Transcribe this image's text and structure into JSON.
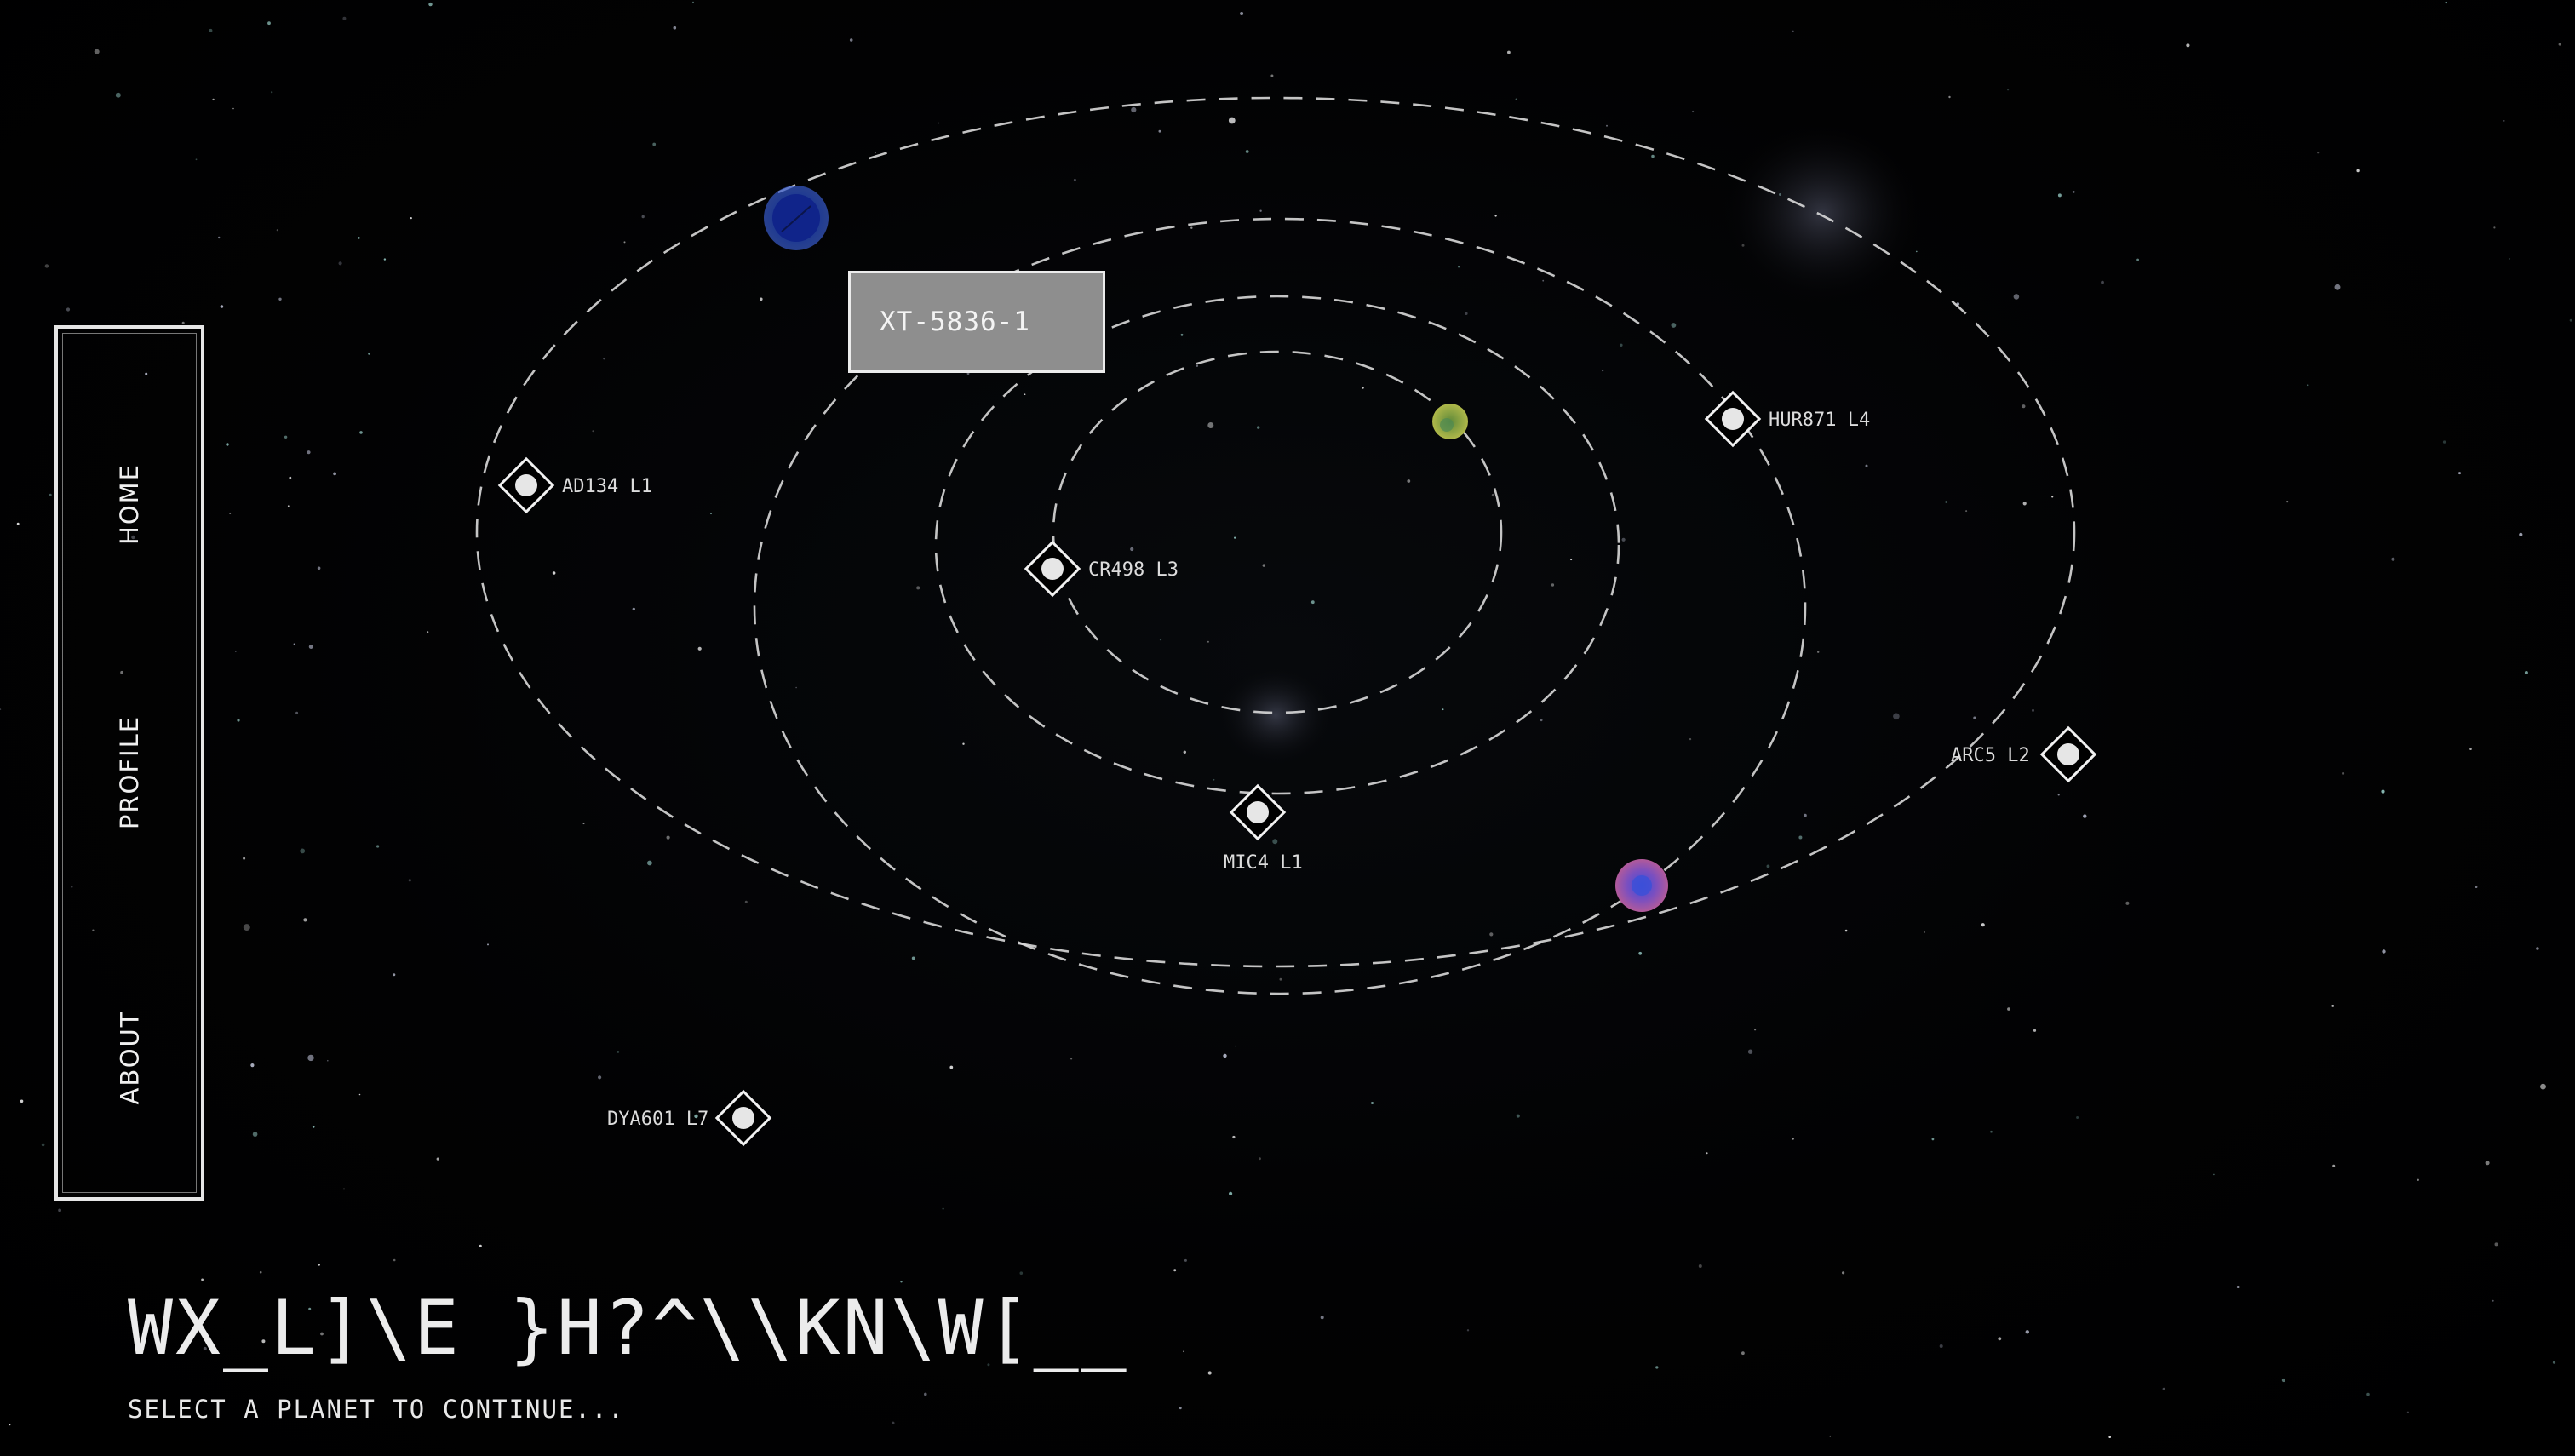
{
  "nav": {
    "items": [
      {
        "label": "HOME"
      },
      {
        "label": "PROFILE"
      },
      {
        "label": "ABOUT"
      }
    ]
  },
  "tooltip": {
    "label": "XT-5836-1"
  },
  "stations": [
    {
      "label": "AD134 L1"
    },
    {
      "label": "HUR871 L4"
    },
    {
      "label": "CR498 L3"
    },
    {
      "label": "MIC4 L1"
    },
    {
      "label": "ARC5 L2"
    },
    {
      "label": "DYA601 L7"
    }
  ],
  "planets": [
    {
      "name": "blue-planet",
      "color": "#1f3fa8"
    },
    {
      "name": "green-planet",
      "color": "#8fae3f"
    },
    {
      "name": "purple-planet",
      "color": "#8a4fb0"
    }
  ],
  "title": {
    "text": "WX_L]\\E }H?^\\\\KN\\W[__",
    "subtitle": "SELECT A PLANET TO CONTINUE..."
  },
  "colors": {
    "background": "#000000",
    "orbit": "#d9d9d9",
    "tooltip_bg": "#8e8e8e"
  }
}
